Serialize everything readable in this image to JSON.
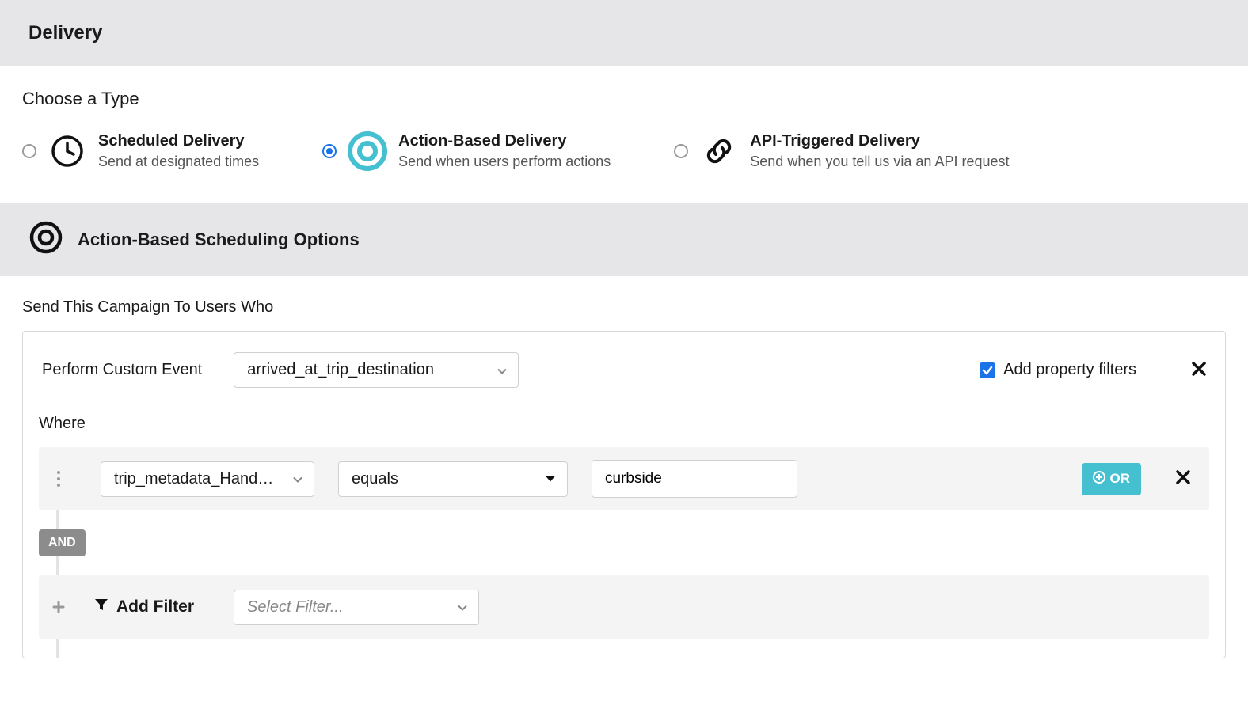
{
  "delivery": {
    "header": "Delivery",
    "choose_type_label": "Choose a Type",
    "options": {
      "scheduled": {
        "title": "Scheduled Delivery",
        "desc": "Send at designated times"
      },
      "action": {
        "title": "Action-Based Delivery",
        "desc": "Send when users perform actions"
      },
      "api": {
        "title": "API-Triggered Delivery",
        "desc": "Send when you tell us via an API request"
      }
    },
    "selected": "action"
  },
  "schedule": {
    "header": "Action-Based Scheduling Options",
    "send_label": "Send This Campaign To Users Who",
    "perform_label": "Perform Custom Event",
    "event_dropdown_value": "arrived_at_trip_destination",
    "property_filter_label": "Add property filters",
    "property_filter_checked": true,
    "where_label": "Where",
    "filter": {
      "property": "trip_metadata_Hand…",
      "operator": "equals",
      "value": "curbside",
      "or_button": "OR"
    },
    "and_badge": "AND",
    "add_filter_label": "Add Filter",
    "select_filter_placeholder": "Select Filter..."
  }
}
